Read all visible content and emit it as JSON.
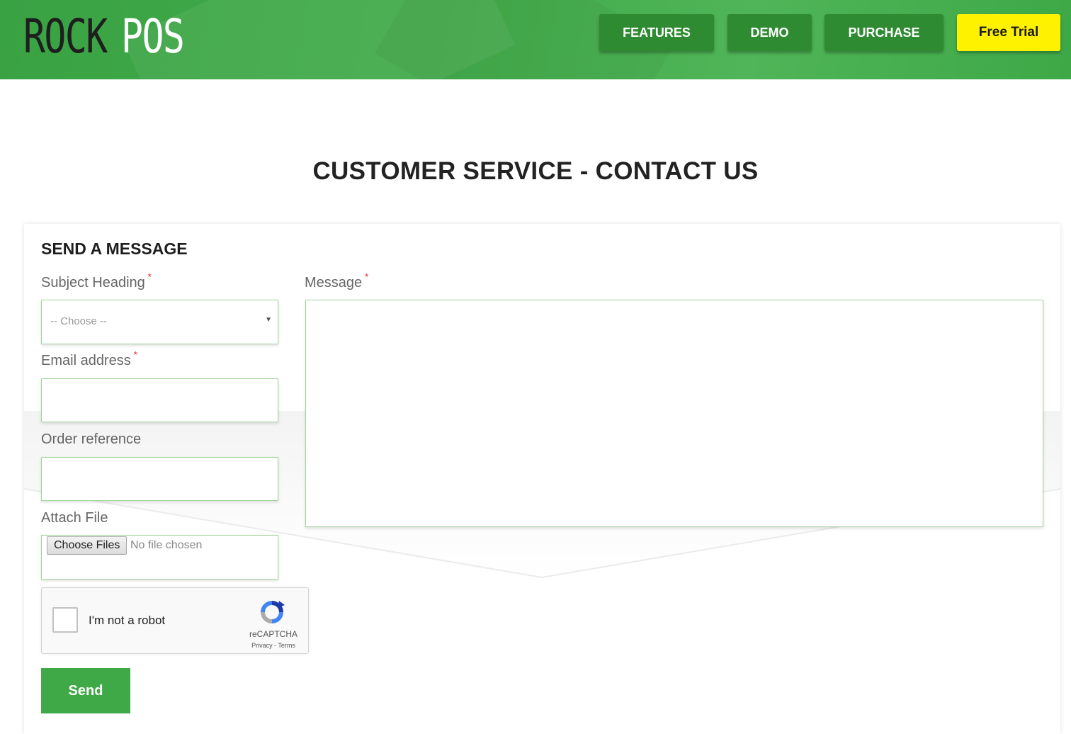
{
  "header": {
    "logo": {
      "part1": "ROCK",
      "part2": "POS"
    },
    "nav": [
      {
        "label": "FEATURES"
      },
      {
        "label": "DEMO"
      },
      {
        "label": "PURCHASE"
      },
      {
        "label": "Free Trial"
      }
    ]
  },
  "page": {
    "title": "CUSTOMER SERVICE - CONTACT US"
  },
  "form": {
    "heading": "SEND A MESSAGE",
    "required_mark": "*",
    "subject": {
      "label": "Subject Heading",
      "selected": "-- Choose --"
    },
    "email": {
      "label": "Email address",
      "value": ""
    },
    "order": {
      "label": "Order reference",
      "value": ""
    },
    "attach": {
      "label": "Attach File",
      "button": "Choose Files",
      "status": "No file chosen"
    },
    "message": {
      "label": "Message",
      "value": ""
    },
    "captcha": {
      "text": "I'm not a robot",
      "brand": "reCAPTCHA",
      "links": "Privacy - Terms"
    },
    "send": "Send"
  },
  "colors": {
    "brand_green": "#3fa847",
    "nav_button": "#2e8b31",
    "trial_button": "#fff200",
    "field_border": "#9fd69a"
  },
  "icons": {
    "select_arrow": "chevron-down-icon",
    "captcha": "recaptcha-logo-icon"
  }
}
